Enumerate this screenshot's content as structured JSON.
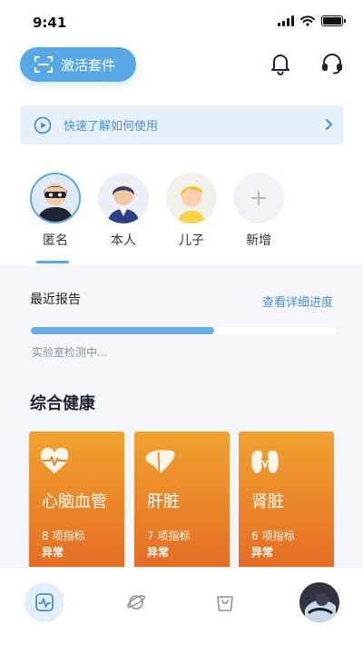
{
  "status_bar": {
    "time": "9:41"
  },
  "header": {
    "activate_label": "激活套件"
  },
  "banner": {
    "text": "快速了解如何使用"
  },
  "profiles": [
    {
      "name": "匿名",
      "selected": true
    },
    {
      "name": "本人",
      "selected": false
    },
    {
      "name": "儿子",
      "selected": false
    },
    {
      "name": "新增",
      "selected": false
    }
  ],
  "report": {
    "title": "最近报告",
    "link": "查看详细进度",
    "progress": 0.6,
    "status": "实验室检测中..."
  },
  "health": {
    "title": "综合健康",
    "cards": [
      {
        "icon": "heart-pulse-icon",
        "name": "心脑血管",
        "count": "8 项指标",
        "status": "异常"
      },
      {
        "icon": "liver-icon",
        "name": "肝脏",
        "count": "7 项指标",
        "status": "异常"
      },
      {
        "icon": "kidney-icon",
        "name": "肾脏",
        "count": "6 项指标",
        "status": "异常"
      }
    ]
  },
  "tabbar": [
    "health-pulse-icon",
    "planet-icon",
    "shopping-bag-icon",
    "user-avatar"
  ],
  "colors": {
    "accent": "#5aa7e6",
    "card_orange": "#ea8428",
    "banner_bg": "#e6f1fc"
  }
}
